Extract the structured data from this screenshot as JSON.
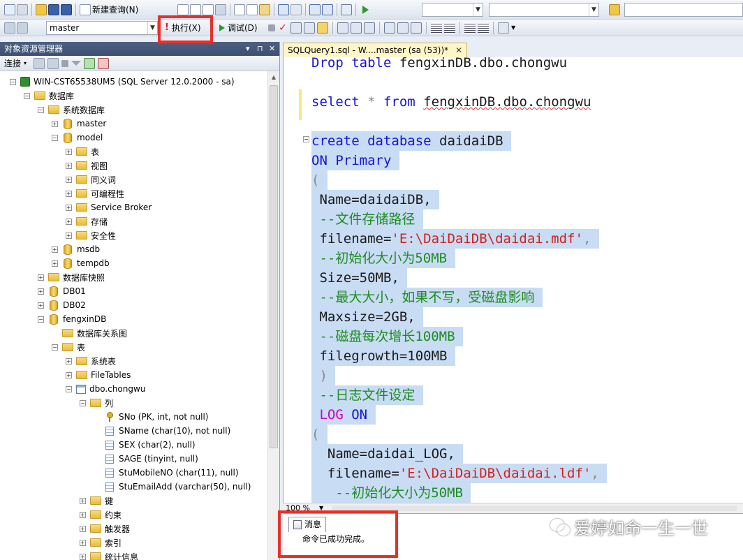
{
  "toolbar1": {
    "new_query_label": "新建查询(N)"
  },
  "toolbar2": {
    "database_value": "master",
    "execute_label": "执行(X)",
    "debug_label": "调试(D)"
  },
  "object_explorer": {
    "title": "对象资源管理器",
    "pin_glyph": "▾ ⊓ ✕",
    "connect_label": "连接",
    "tree": [
      {
        "label": "WIN-CST65538UM5 (SQL Server 12.0.2000 - sa)",
        "icon": "server-icon",
        "exp": "−"
      },
      {
        "label": "数据库",
        "icon": "folder-icon",
        "exp": "−"
      },
      {
        "label": "系统数据库",
        "icon": "folder-icon",
        "exp": "−"
      },
      {
        "label": "master",
        "icon": "database-icon",
        "exp": "+"
      },
      {
        "label": "model",
        "icon": "database-icon",
        "exp": "−"
      },
      {
        "label": "表",
        "icon": "folder-icon",
        "exp": "+"
      },
      {
        "label": "视图",
        "icon": "folder-icon",
        "exp": "+"
      },
      {
        "label": "同义词",
        "icon": "folder-icon",
        "exp": "+"
      },
      {
        "label": "可编程性",
        "icon": "folder-icon",
        "exp": "+"
      },
      {
        "label": "Service Broker",
        "icon": "folder-icon",
        "exp": "+"
      },
      {
        "label": "存储",
        "icon": "folder-icon",
        "exp": "+"
      },
      {
        "label": "安全性",
        "icon": "folder-icon",
        "exp": "+"
      },
      {
        "label": "msdb",
        "icon": "database-icon",
        "exp": "+"
      },
      {
        "label": "tempdb",
        "icon": "database-icon",
        "exp": "+"
      },
      {
        "label": "数据库快照",
        "icon": "folder-icon",
        "exp": "+"
      },
      {
        "label": "DB01",
        "icon": "database-icon",
        "exp": "+"
      },
      {
        "label": "DB02",
        "icon": "database-icon",
        "exp": "+"
      },
      {
        "label": "fengxinDB",
        "icon": "database-icon",
        "exp": "−"
      },
      {
        "label": "数据库关系图",
        "icon": "folder-icon",
        "exp": ""
      },
      {
        "label": "表",
        "icon": "folder-icon",
        "exp": "−"
      },
      {
        "label": "系统表",
        "icon": "folder-icon",
        "exp": "+"
      },
      {
        "label": "FileTables",
        "icon": "folder-icon",
        "exp": "+"
      },
      {
        "label": "dbo.chongwu",
        "icon": "table-icon",
        "exp": "−"
      },
      {
        "label": "列",
        "icon": "folder-icon",
        "exp": "−"
      },
      {
        "label": "SNo (PK, int, not null)",
        "icon": "key-icon",
        "exp": ""
      },
      {
        "label": "SName (char(10), not null)",
        "icon": "column-icon",
        "exp": ""
      },
      {
        "label": "SEX (char(2), null)",
        "icon": "column-icon",
        "exp": ""
      },
      {
        "label": "SAGE (tinyint, null)",
        "icon": "column-icon",
        "exp": ""
      },
      {
        "label": "StuMobileNO (char(11), null)",
        "icon": "column-icon",
        "exp": ""
      },
      {
        "label": "StuEmailAdd (varchar(50), null)",
        "icon": "column-icon",
        "exp": ""
      },
      {
        "label": "键",
        "icon": "folder-icon",
        "exp": "+"
      },
      {
        "label": "约束",
        "icon": "folder-icon",
        "exp": "+"
      },
      {
        "label": "触发器",
        "icon": "folder-icon",
        "exp": "+"
      },
      {
        "label": "索引",
        "icon": "folder-icon",
        "exp": "+"
      },
      {
        "label": "统计信息",
        "icon": "folder-icon",
        "exp": "+"
      }
    ]
  },
  "editor": {
    "tab_label": "SQLQuery1.sql - W....master (sa (53))*",
    "tab_close": "✕",
    "code": {
      "l0a": "Drop",
      "l0b": " table ",
      "l0c": "fengxinDB.dbo.chongwu",
      "l1a": "select",
      "l1b": " * ",
      "l1c": "from",
      "l1d": " ",
      "l1e": "fengxinDB.dbo.chongwu",
      "l2a": "create database",
      "l2b": " daidaiDB ",
      "l3a": "ON Primary",
      "l3b": " ",
      "l4": "( ",
      "l5": " Name=daidaiDB, ",
      "l6": " --文件存储路径 ",
      "l7a": " filename=",
      "l7b": "'E:\\DaiDaiDB\\daidai.mdf'",
      "l7c": ", ",
      "l8": " --初始化大小为50MB ",
      "l9": " Size=50MB, ",
      "l10": " --最大大小，如果不写，受磁盘影响 ",
      "l11": " Maxsize=2GB, ",
      "l12": " --磁盘每次增长100MB ",
      "l13": " filegrowth=100MB ",
      "l14": " ) ",
      "l15": " --日志文件设定 ",
      "l16a": " LOG",
      "l16b": " ON ",
      "l17": "( ",
      "l18": "  Name=daidai_LOG, ",
      "l19a": "  filename=",
      "l19b": "'E:\\DaiDaiDB\\daidai.ldf'",
      "l19c": ", ",
      "l20": "   --初始化大小为50MB "
    },
    "zoom": "100 %"
  },
  "results": {
    "tab_label": "消息",
    "message": "命令已成功完成。"
  },
  "watermark": "爱婷如命一生一世",
  "colors": {
    "keyword": "#1515d8",
    "comment": "#1e8c1e",
    "string": "#d4211c",
    "selection": "#c8dcf4",
    "highlight_box": "#e8302a"
  }
}
